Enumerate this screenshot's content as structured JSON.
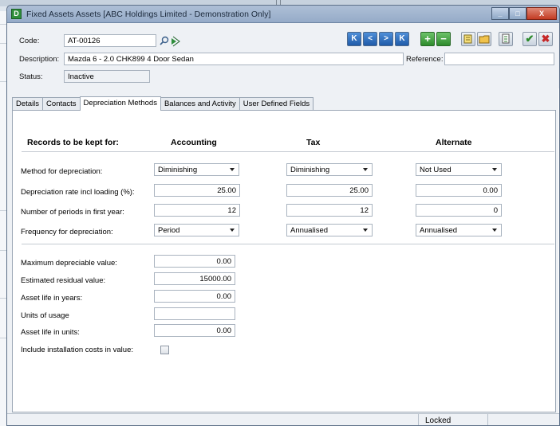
{
  "window": {
    "title": "Fixed Assets Assets [ABC Holdings Limited - Demonstration Only]",
    "app_icon": "D",
    "controls": {
      "minimize": "_",
      "maximize": "□",
      "close": "X"
    }
  },
  "header": {
    "code_label": "Code:",
    "code_value": "AT-00126",
    "description_label": "Description:",
    "description_value": "Mazda 6 - 2.0 CHK899 4 Door Sedan",
    "status_label": "Status:",
    "status_value": "Inactive",
    "reference_label": "Reference:",
    "reference_value": ""
  },
  "toolbar": {
    "first": "K",
    "prev": "<",
    "next": ">",
    "last": "K",
    "add": "+",
    "delete": "−",
    "ok": "✔",
    "cancel": "✖"
  },
  "tabs": [
    {
      "label": "Details"
    },
    {
      "label": "Contacts"
    },
    {
      "label": "Depreciation Methods"
    },
    {
      "label": "Balances and Activity"
    },
    {
      "label": "User Defined Fields"
    }
  ],
  "depreciation": {
    "records_heading": "Records to be kept for:",
    "columns": {
      "accounting": "Accounting",
      "tax": "Tax",
      "alternate": "Alternate"
    },
    "rows": {
      "method": {
        "label": "Method for depreciation:",
        "accounting": "Diminishing",
        "tax": "Diminishing",
        "alternate": "Not Used"
      },
      "rate": {
        "label": "Depreciation rate incl loading (%):",
        "accounting": "25.00",
        "tax": "25.00",
        "alternate": "0.00"
      },
      "periods": {
        "label": "Number of periods in first year:",
        "accounting": "12",
        "tax": "12",
        "alternate": "0"
      },
      "frequency": {
        "label": "Frequency for depreciation:",
        "accounting": "Period",
        "tax": "Annualised",
        "alternate": "Annualised"
      }
    },
    "lower": {
      "max_value_label": "Maximum depreciable value:",
      "max_value": "0.00",
      "residual_label": "Estimated residual value:",
      "residual_value": "15000.00",
      "life_years_label": "Asset life in years:",
      "life_years": "0.00",
      "units_usage_label": "Units of usage",
      "units_usage": "",
      "life_units_label": "Asset life in units:",
      "life_units": "0.00",
      "install_costs_label": "Include installation costs in value:"
    }
  },
  "statusbar": {
    "lock_state": "Locked"
  }
}
